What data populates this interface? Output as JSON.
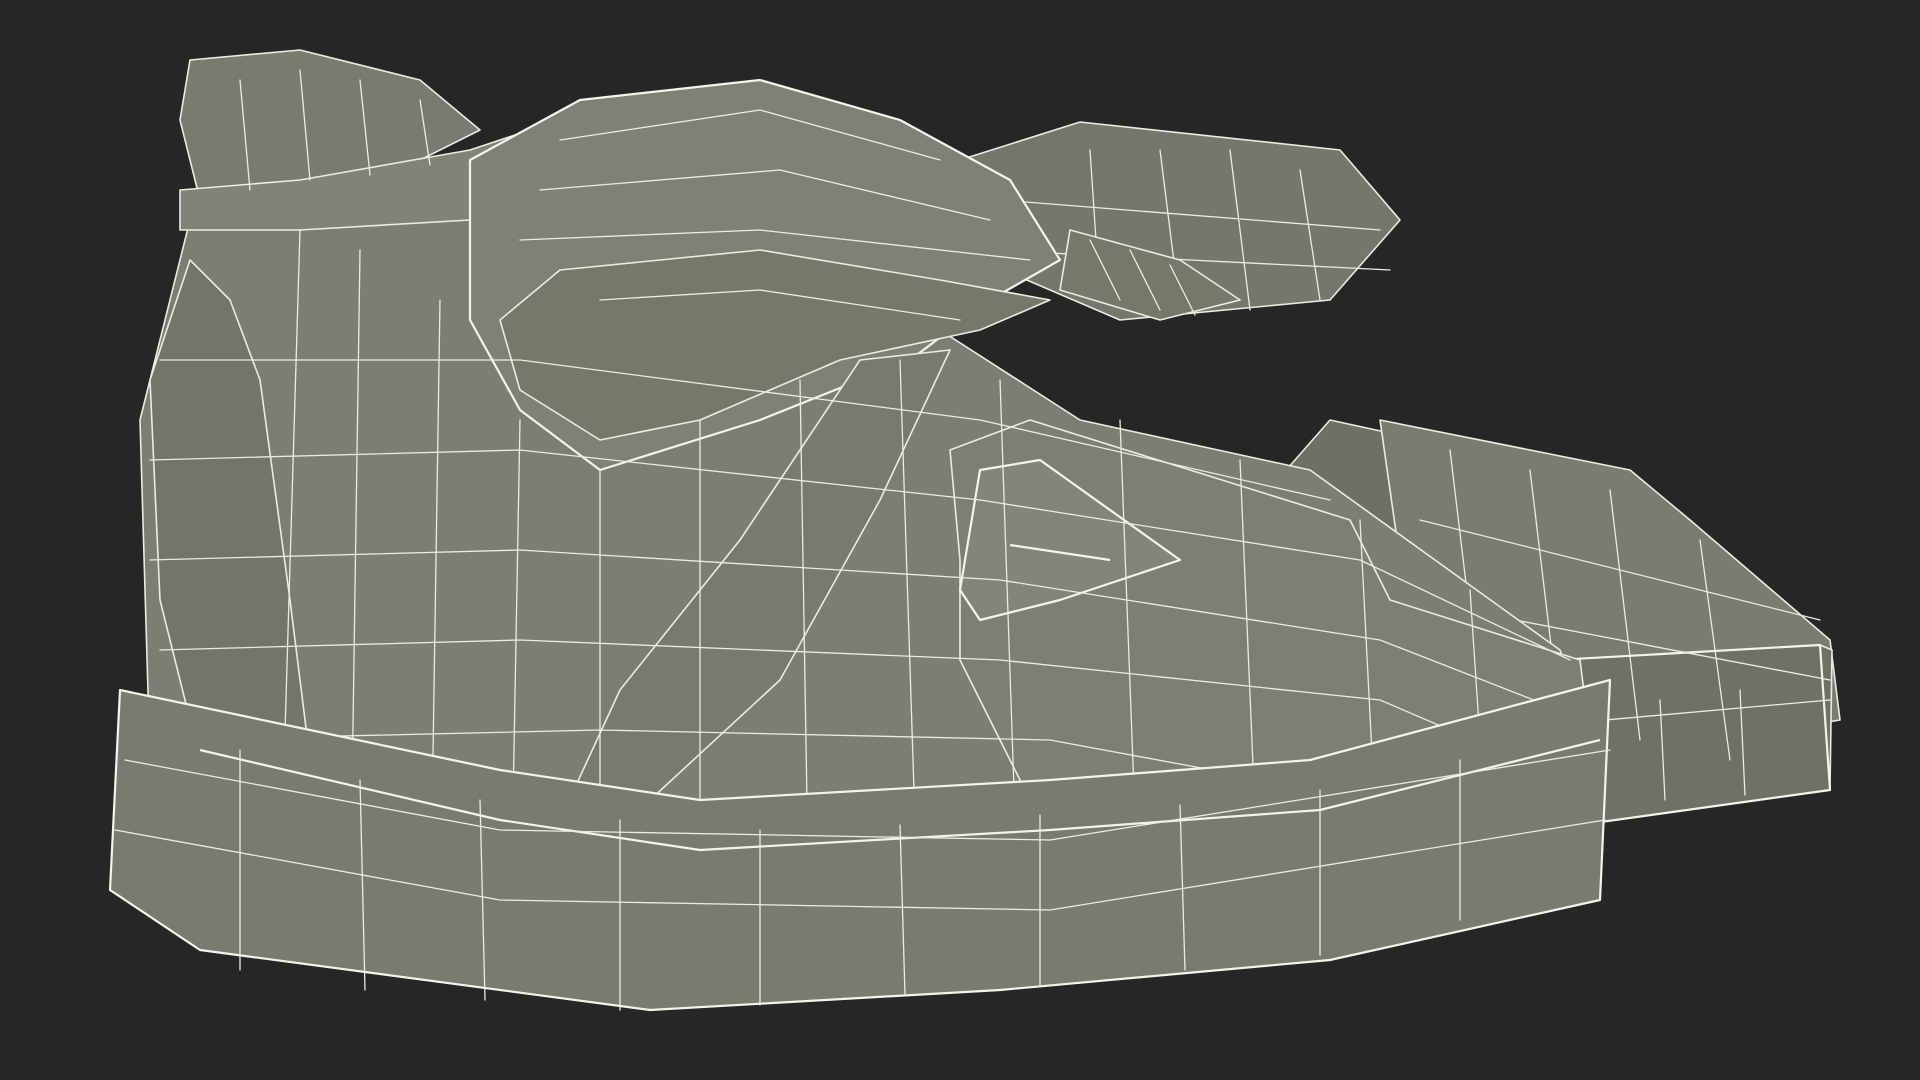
{
  "scene": {
    "subject": "sneaker-pair-wireframe-render",
    "background_color": "#262626",
    "mesh_color": "#7d7e72",
    "mesh_shade_color": "#6d6e63",
    "wire_color": "#ecebe1"
  }
}
